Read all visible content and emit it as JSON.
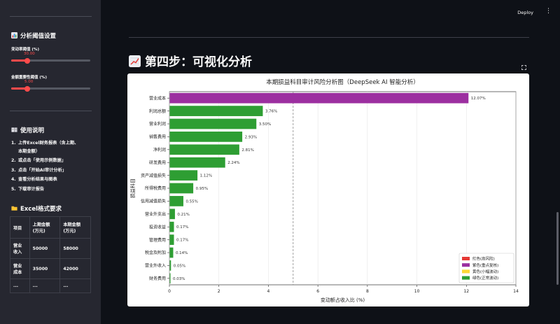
{
  "sidebar": {
    "threshold_title": "分析阈值设置",
    "change_rate_label": "变动率阈值 (%)",
    "change_rate_value": "30.00",
    "change_rate_fraction": 0.2,
    "materiality_label": "金额重要性阈值 (%)",
    "materiality_value": "5.00",
    "materiality_fraction": 0.2,
    "instructions_title": "使用说明",
    "steps": [
      {
        "num": "1.",
        "text": "上传Excel财务报表（含上期、",
        "cont": "本期金额）"
      },
      {
        "num": "2.",
        "text": "或点击「使用示例数据」",
        "cont": ""
      },
      {
        "num": "3.",
        "text": "点击「开始AI审计分析」",
        "cont": ""
      },
      {
        "num": "4.",
        "text": "查看分析结果与图表",
        "cont": ""
      },
      {
        "num": "5.",
        "text": "下载审计报告",
        "cont": ""
      }
    ],
    "format_title": "Excel格式要求",
    "format_table": {
      "headers": [
        "项目",
        "上期金额\n(万元)",
        "本期金额\n(万元)"
      ],
      "rows": [
        [
          "营业\n收入",
          "50000",
          "58000"
        ],
        [
          "营业\n成本",
          "35000",
          "42000"
        ],
        [
          "...",
          "...",
          "..."
        ]
      ]
    }
  },
  "header": {
    "deploy_label": "Deploy",
    "menu_icon": "⋮"
  },
  "main": {
    "step_title": "第四步：可视化分析"
  },
  "chart_data": {
    "type": "bar",
    "orientation": "horizontal",
    "title": "本期损益科目审计风险分析图（DeepSeek AI 智能分析）",
    "xlabel": "变动额占收入比 (%)",
    "ylabel": "损益科目",
    "xlim": [
      0,
      14
    ],
    "xticks": [
      0,
      2,
      4,
      6,
      8,
      10,
      12,
      14
    ],
    "reference_line_x": 5,
    "grid": true,
    "legend_position": "bottom-right",
    "categories": [
      "营业成本",
      "利润总额",
      "营业利润",
      "销售费用",
      "净利润",
      "研发费用",
      "资产减值损失",
      "所得税费用",
      "信用减值损失",
      "营业外支出",
      "投资收益",
      "管理费用",
      "税金及附加",
      "营业外收入",
      "财务费用"
    ],
    "values": [
      12.07,
      3.76,
      3.5,
      2.93,
      2.81,
      2.24,
      1.12,
      0.95,
      0.55,
      0.21,
      0.17,
      0.17,
      0.14,
      0.05,
      0.03
    ],
    "value_labels": [
      "12.07%",
      "3.76%",
      "3.50%",
      "2.93%",
      "2.81%",
      "2.24%",
      "1.12%",
      "0.95%",
      "0.55%",
      "0.21%",
      "0.17%",
      "0.17%",
      "0.14%",
      "0.05%",
      "0.03%"
    ],
    "bar_levels": [
      "purple",
      "green",
      "green",
      "green",
      "green",
      "green",
      "green",
      "green",
      "green",
      "green",
      "green",
      "green",
      "green",
      "green",
      "green"
    ],
    "legend": [
      {
        "key": "red",
        "label": "红色(高风险)",
        "color": "#e53935"
      },
      {
        "key": "purple",
        "label": "紫色(重点复核)",
        "color": "#9c2fa0"
      },
      {
        "key": "yellow",
        "label": "黄色(小幅波动)",
        "color": "#fdd835"
      },
      {
        "key": "green",
        "label": "绿色(正常波动)",
        "color": "#2e9e33"
      }
    ]
  },
  "colors": {
    "accent": "#ff4b4b",
    "sidebar_bg": "#262730",
    "main_bg": "#0e1117"
  }
}
